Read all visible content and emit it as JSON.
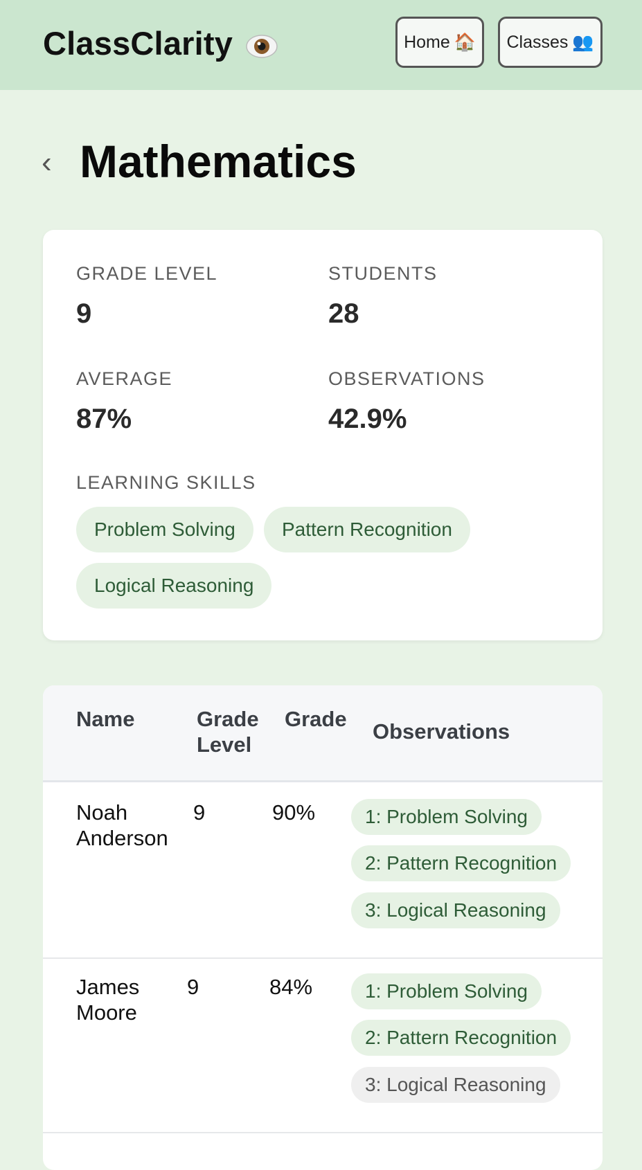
{
  "app": {
    "brand": "ClassClarity",
    "brand_icon": "eye-icon",
    "nav": [
      {
        "label": "Home",
        "icon": "🏠"
      },
      {
        "label": "Classes",
        "icon": "👥"
      }
    ]
  },
  "page": {
    "back_glyph": "‹",
    "title": "Mathematics"
  },
  "summary": {
    "grade_level_label": "GRADE LEVEL",
    "grade_level_value": "9",
    "students_label": "STUDENTS",
    "students_value": "28",
    "average_label": "AVERAGE",
    "average_value": "87%",
    "observations_label": "OBSERVATIONS",
    "observations_value": "42.9%",
    "skills_label": "LEARNING SKILLS",
    "skills": [
      "Problem Solving",
      "Pattern Recognition",
      "Logical Reasoning"
    ]
  },
  "table": {
    "headers": {
      "name": "Name",
      "grade_level_1": "Grade",
      "grade_level_2": "Level",
      "grade": "Grade",
      "observations": "Observations"
    },
    "rows": [
      {
        "name_first": "Noah",
        "name_last": "Anderson",
        "grade_level": "9",
        "grade": "90%",
        "observations": [
          {
            "text": "1: Problem Solving",
            "state": "active"
          },
          {
            "text": "2: Pattern Recognition",
            "state": "active"
          },
          {
            "text": "3: Logical Reasoning",
            "state": "active"
          }
        ]
      },
      {
        "name_first": "James",
        "name_last": "Moore",
        "grade_level": "9",
        "grade": "84%",
        "observations": [
          {
            "text": "1: Problem Solving",
            "state": "active"
          },
          {
            "text": "2: Pattern Recognition",
            "state": "active"
          },
          {
            "text": "3: Logical Reasoning",
            "state": "inactive"
          }
        ]
      }
    ]
  },
  "colors": {
    "header_bg": "#cbe6cf",
    "page_bg": "#e8f3e6",
    "chip_bg": "#e6f2e4",
    "chip_text": "#2e5c37",
    "chip_muted_bg": "#efefef"
  }
}
